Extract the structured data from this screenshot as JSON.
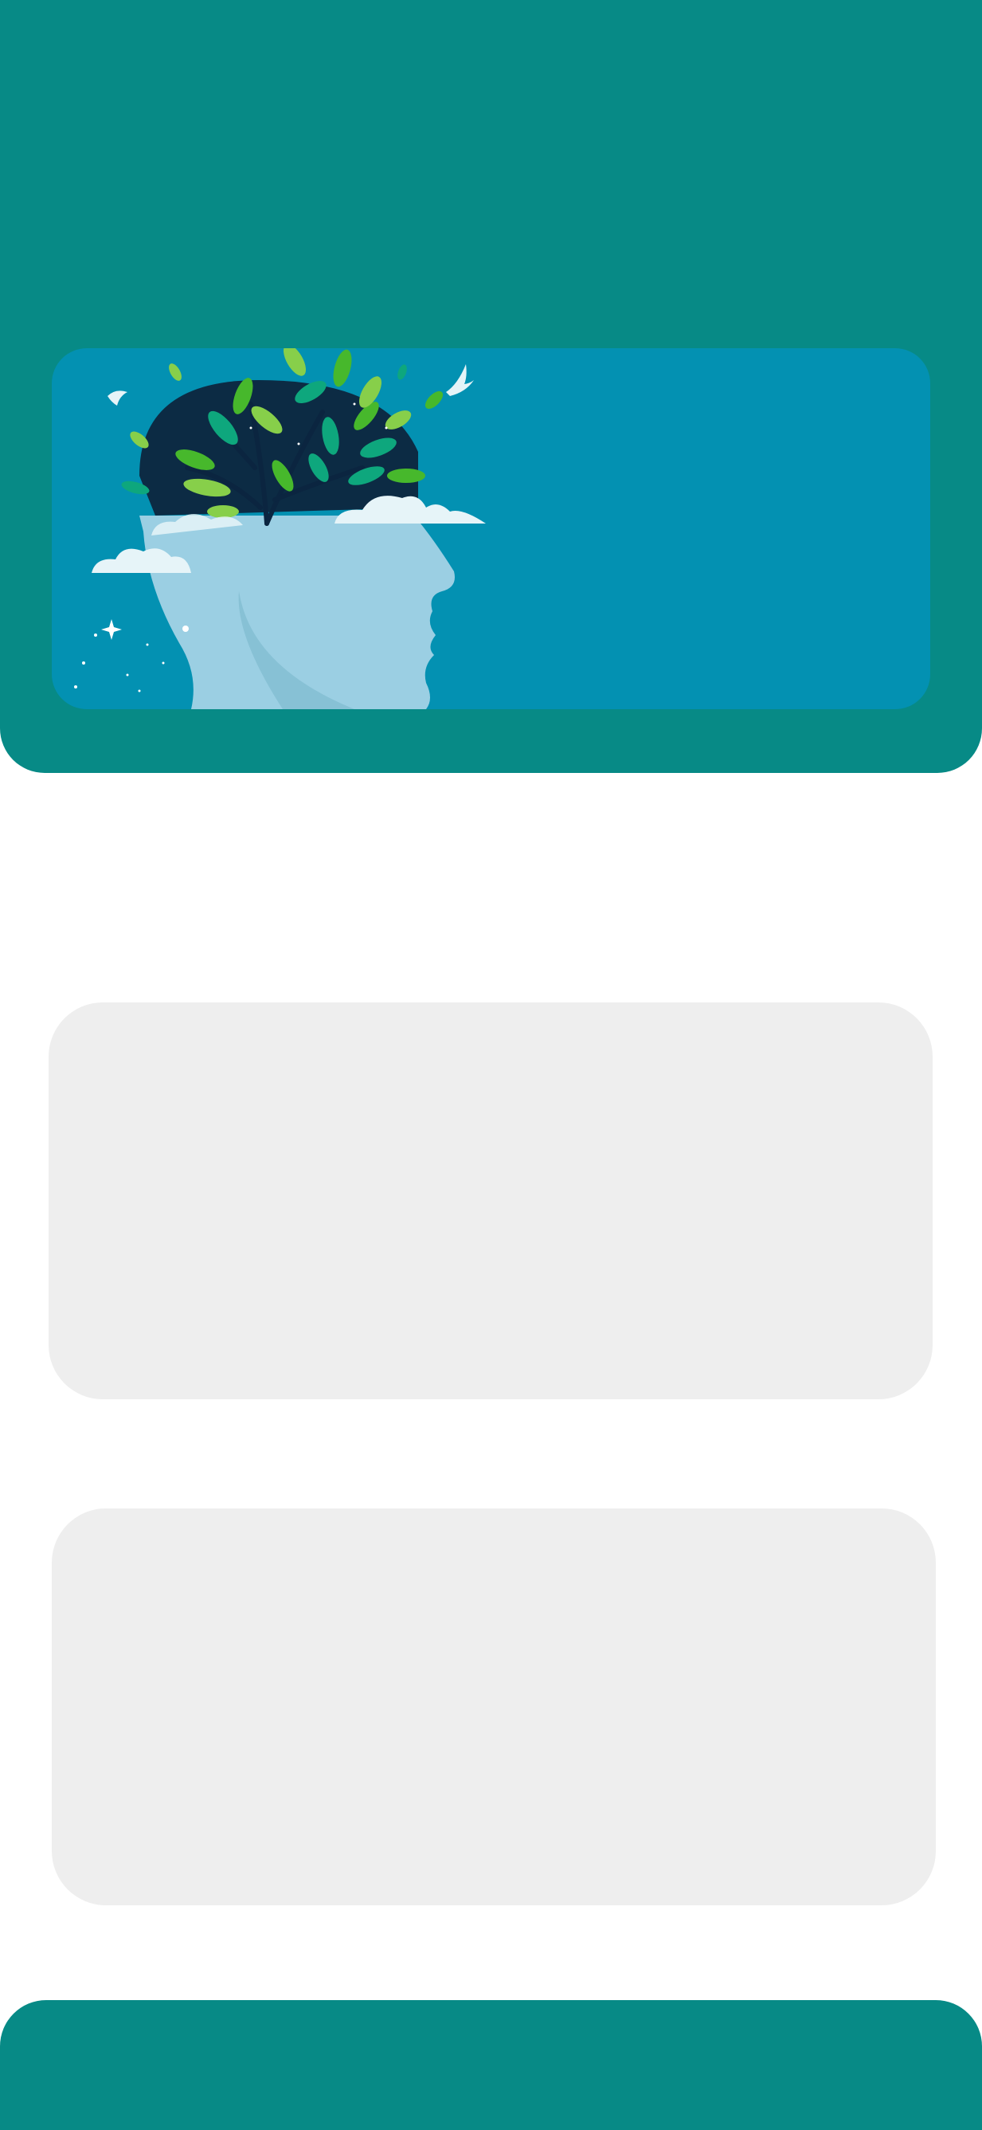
{
  "colors": {
    "header_bg": "#078a86",
    "hero_bg": "#0391b2",
    "placeholder_bg": "#eeeeee",
    "footer_bg": "#078a86",
    "head_fill": "#9bcfe3",
    "tree_canopy": "#0c2b44",
    "leaf_green": "#47b82c",
    "leaf_light": "#87cf4a",
    "leaf_teal": "#0ea77d",
    "cloud": "#e6f4f8"
  },
  "hero": {
    "illustration": "mind-tree-head-illustration"
  },
  "placeholders": [
    {
      "name": "content-placeholder-1"
    },
    {
      "name": "content-placeholder-2"
    }
  ]
}
